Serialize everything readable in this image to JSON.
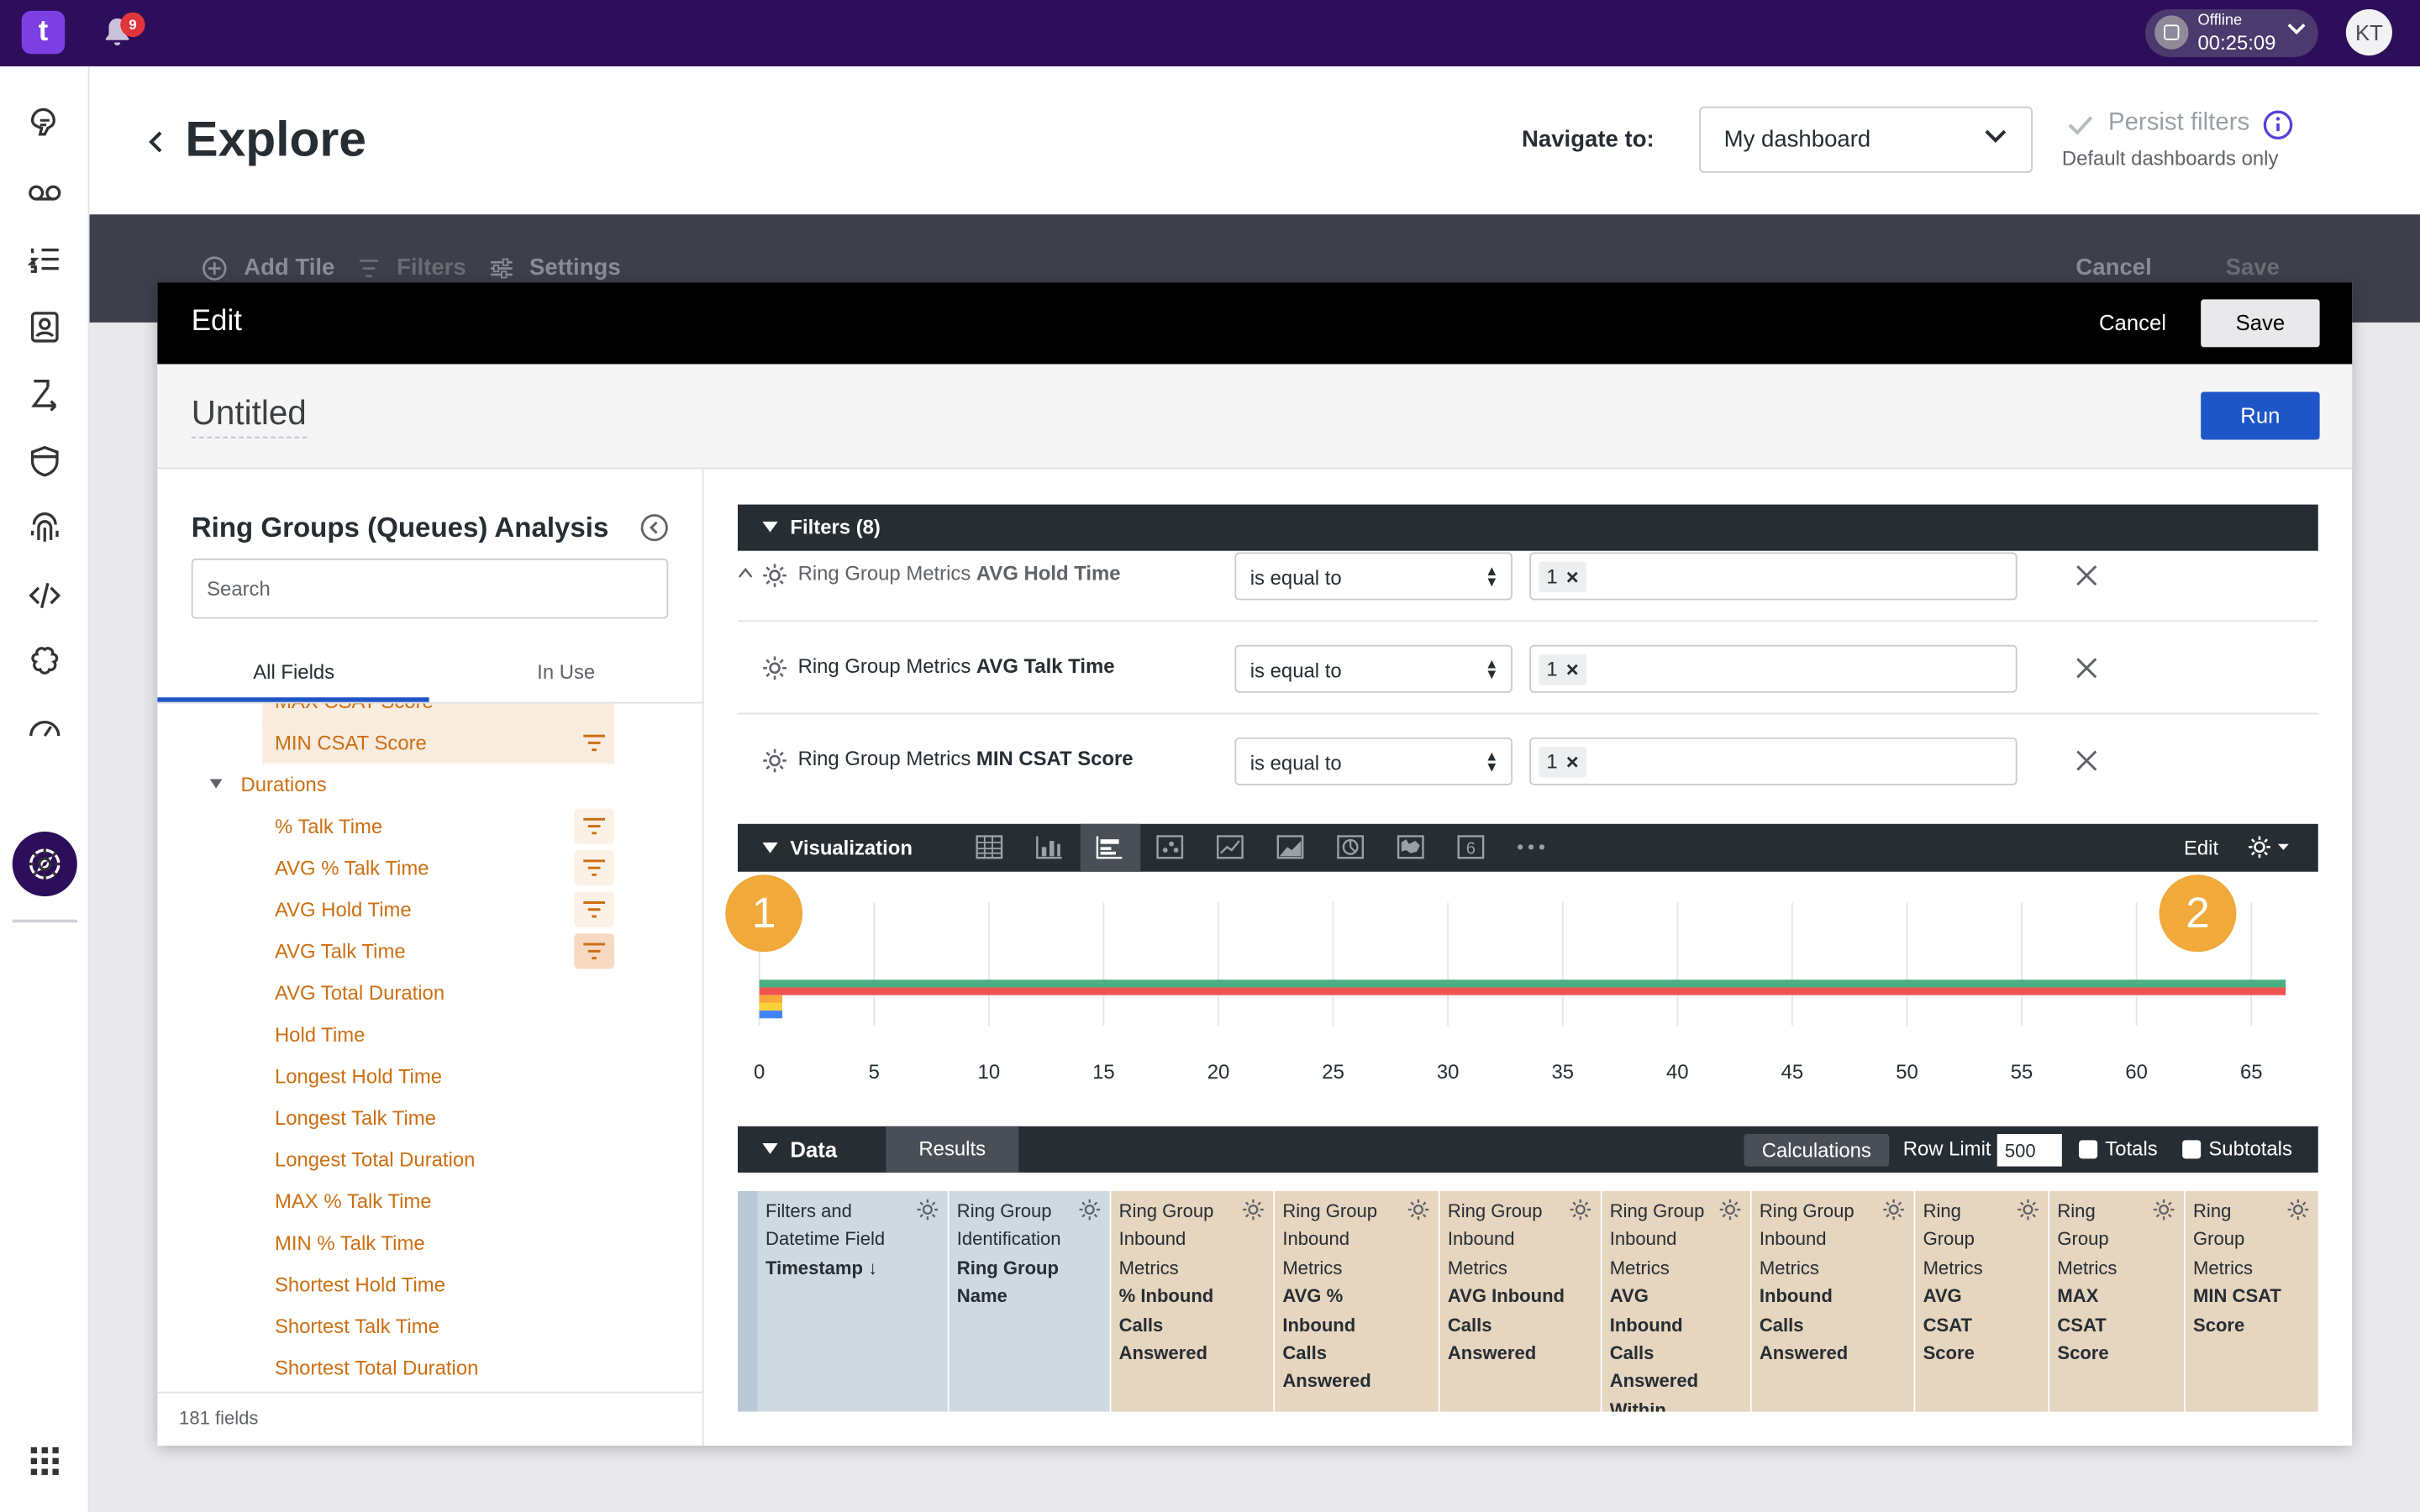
{
  "topbar": {
    "notifications": "9",
    "status_label": "Offline",
    "status_time": "00:25:09",
    "avatar_initials": "KT",
    "logo": "t"
  },
  "header": {
    "title": "Explore",
    "navigate_label": "Navigate to:",
    "navigate_value": "My dashboard",
    "persist_label": "Persist filters",
    "persist_sub": "Default dashboards only"
  },
  "dashboard_toolbar": {
    "add_tile": "Add Tile",
    "filters": "Filters",
    "settings": "Settings",
    "cancel": "Cancel",
    "save": "Save"
  },
  "modal": {
    "title": "Edit",
    "cancel": "Cancel",
    "save": "Save",
    "query_title": "Untitled",
    "run": "Run"
  },
  "picker": {
    "explore_name": "Ring Groups (Queues) Analysis",
    "search_placeholder": "Search",
    "tab_all": "All Fields",
    "tab_in_use": "In Use",
    "partial_field": "MAX CSAT Score",
    "fields_before": [
      "MIN CSAT Score"
    ],
    "group": "Durations",
    "fields": [
      "% Talk Time",
      "AVG % Talk Time",
      "AVG Hold Time",
      "AVG Talk Time",
      "AVG Total Duration",
      "Hold Time",
      "Longest Hold Time",
      "Longest Talk Time",
      "Longest Total Duration",
      "MAX % Talk Time",
      "MIN % Talk Time",
      "Shortest Hold Time",
      "Shortest Talk Time",
      "Shortest Total Duration"
    ],
    "field_count": "181 fields"
  },
  "filters": {
    "title": "Filters (8)",
    "rows": [
      {
        "view": "Ring Group Metrics",
        "field": "AVG Hold Time",
        "operator": "is equal to",
        "value": "1"
      },
      {
        "view": "Ring Group Metrics",
        "field": "AVG Talk Time",
        "operator": "is equal to",
        "value": "1"
      },
      {
        "view": "Ring Group Metrics",
        "field": "MIN CSAT Score",
        "operator": "is equal to",
        "value": "1"
      }
    ]
  },
  "visualization": {
    "title": "Visualization",
    "edit": "Edit",
    "type_icons": [
      "table-icon",
      "column-chart-icon",
      "bar-chart-icon",
      "scatter-icon",
      "line-chart-icon",
      "area-chart-icon",
      "pie-chart-icon",
      "map-icon",
      "single-value-icon",
      "more-icon"
    ],
    "selected_type": "bar-chart-icon",
    "markers": [
      "1",
      "2"
    ]
  },
  "chart_data": {
    "type": "bar",
    "orientation": "horizontal",
    "xlim": [
      0,
      66.5
    ],
    "x_ticks": [
      0,
      5,
      10,
      15,
      20,
      25,
      30,
      35,
      40,
      45,
      50,
      55,
      60,
      65
    ],
    "grid": true,
    "series": [
      {
        "color": "#4caf82",
        "values": [
          66.5
        ]
      },
      {
        "color": "#ef5350",
        "values": [
          66.5
        ]
      },
      {
        "color": "#f7a838",
        "values": [
          1.0
        ]
      },
      {
        "color": "#f9d138",
        "values": [
          1.0
        ]
      },
      {
        "color": "#4285f4",
        "values": [
          1.0
        ]
      }
    ]
  },
  "data_panel": {
    "title": "Data",
    "results_tab": "Results",
    "calculations": "Calculations",
    "row_limit_label": "Row Limit",
    "row_limit": "500",
    "totals": "Totals",
    "subtotals": "Subtotals",
    "columns": [
      {
        "view": "Filters and Datetime Field",
        "field": "Timestamp ↓",
        "kind": "dimension"
      },
      {
        "view": "Ring Group Identification",
        "field": "Ring Group Name",
        "kind": "dimension"
      },
      {
        "view": "Ring Group Inbound Metrics",
        "field": "% Inbound Calls Answered",
        "kind": "measure"
      },
      {
        "view": "Ring Group Inbound Metrics",
        "field": "AVG % Inbound Calls Answered",
        "kind": "measure"
      },
      {
        "view": "Ring Group Inbound Metrics",
        "field": "AVG Inbound Calls Answered",
        "kind": "measure"
      },
      {
        "view": "Ring Group Inbound Metrics",
        "field": "AVG Inbound Calls Answered Within",
        "kind": "measure"
      },
      {
        "view": "Ring Group Inbound Metrics",
        "field": "Inbound Calls Answered",
        "kind": "measure"
      },
      {
        "view": "Ring Group Metrics",
        "field": "AVG CSAT Score",
        "kind": "measure"
      },
      {
        "view": "Ring Group Metrics",
        "field": "MAX CSAT Score",
        "kind": "measure"
      },
      {
        "view": "Ring Group Metrics",
        "field": "MIN CSAT Score",
        "kind": "measure"
      }
    ]
  },
  "colors": {
    "topbar": "#2d0e5a",
    "accent": "#1e56c8",
    "field": "#cc6f12",
    "marker": "#f0a93a"
  }
}
